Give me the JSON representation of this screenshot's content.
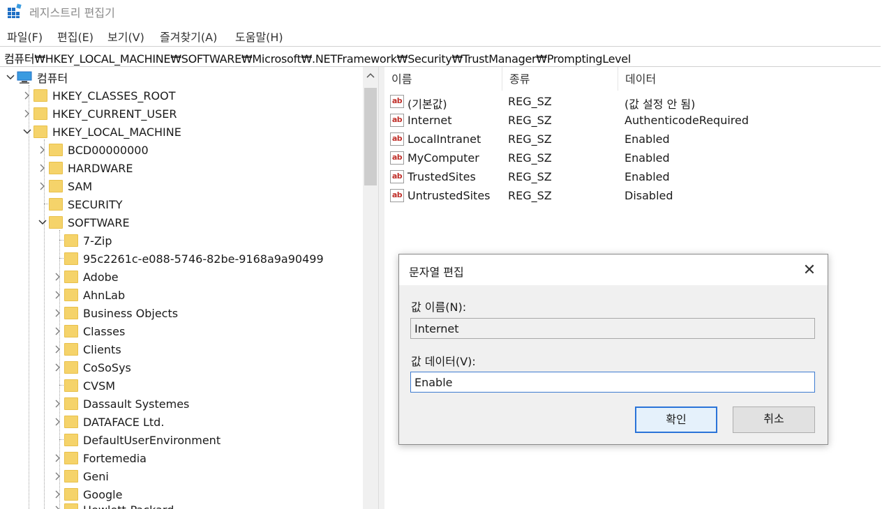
{
  "window": {
    "title": "레지스트리 편집기",
    "icon": "registry-editor-icon"
  },
  "menu": [
    "파일(F)",
    "편집(E)",
    "보기(V)",
    "즐겨찾기(A)",
    "도움말(H)"
  ],
  "address": "컴퓨터₩HKEY_LOCAL_MACHINE₩SOFTWARE₩Microsoft₩.NETFramework₩Security₩TrustManager₩PromptingLevel",
  "tree": {
    "root": "컴퓨터",
    "hives": [
      "HKEY_CLASSES_ROOT",
      "HKEY_CURRENT_USER",
      "HKEY_LOCAL_MACHINE"
    ],
    "hklm_children": [
      "BCD00000000",
      "HARDWARE",
      "SAM",
      "SECURITY",
      "SOFTWARE"
    ],
    "software_children": [
      "7-Zip",
      "95c2261c-e088-5746-82be-9168a9a90499",
      "Adobe",
      "AhnLab",
      "Business Objects",
      "Classes",
      "Clients",
      "CoSoSys",
      "CVSM",
      "Dassault Systemes",
      "DATAFACE Ltd.",
      "DefaultUserEnvironment",
      "Fortemedia",
      "Geni",
      "Google",
      "Hewlett-Packard"
    ]
  },
  "list": {
    "headers": [
      "이름",
      "종류",
      "데이터"
    ],
    "rows": [
      {
        "name": "(기본값)",
        "type": "REG_SZ",
        "data": "(값 설정 안 됨)"
      },
      {
        "name": "Internet",
        "type": "REG_SZ",
        "data": "AuthenticodeRequired"
      },
      {
        "name": "LocalIntranet",
        "type": "REG_SZ",
        "data": "Enabled"
      },
      {
        "name": "MyComputer",
        "type": "REG_SZ",
        "data": "Enabled"
      },
      {
        "name": "TrustedSites",
        "type": "REG_SZ",
        "data": "Enabled"
      },
      {
        "name": "UntrustedSites",
        "type": "REG_SZ",
        "data": "Disabled"
      }
    ],
    "value_icon_text": "ab"
  },
  "dialog": {
    "title": "문자열 편집",
    "name_label": "값 이름(N):",
    "name_value": "Internet",
    "data_label": "값 데이터(V):",
    "data_value": "Enable",
    "ok_label": "확인",
    "cancel_label": "취소",
    "close_glyph": "✕"
  },
  "colors": {
    "folder": "#f5d36a",
    "accent": "#2a73d8",
    "value_icon": "#c0302a"
  }
}
